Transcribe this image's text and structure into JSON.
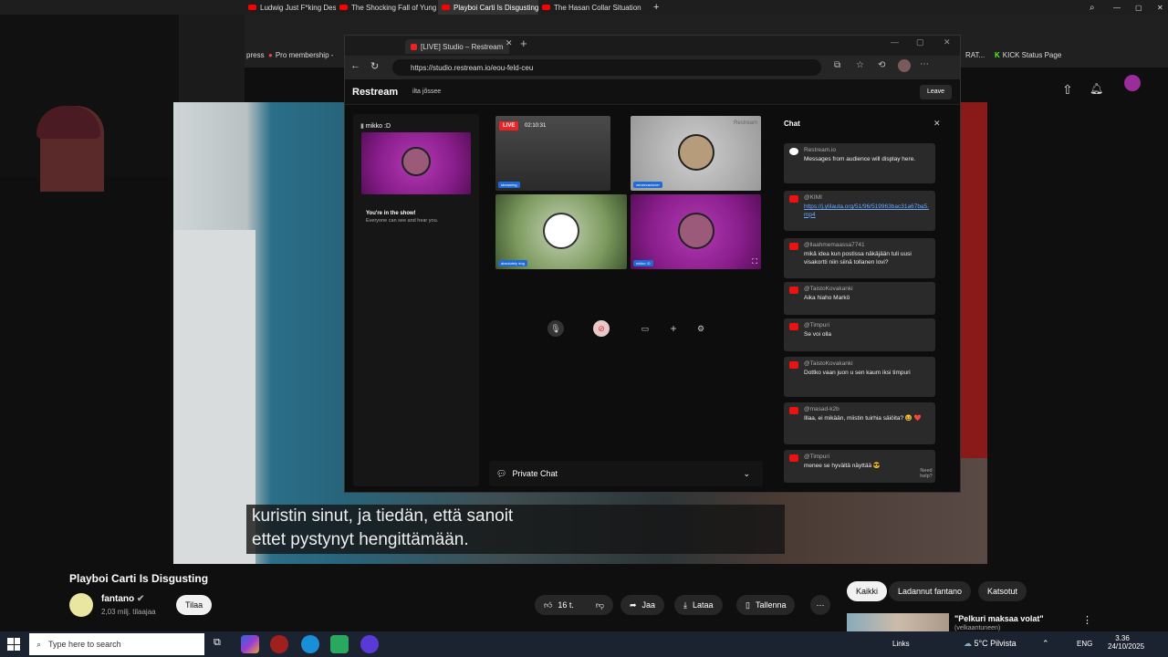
{
  "top_tabs": [
    {
      "label": "Ludwig Just F*king Destr"
    },
    {
      "label": "The Shocking Fall of Yung"
    },
    {
      "label": "Playboi Carti Is Disgusting"
    },
    {
      "label": "The Hasan Collar Situation"
    }
  ],
  "bookmarks": {
    "left": "press",
    "membership": "Pro membership -",
    "right1": "RAT...",
    "kick": "KICK Status Page"
  },
  "restream": {
    "tab_title": "[LIVE] Studio – Restream",
    "url": "https://studio.restream.io/eou-feld-ceu",
    "brand": "Restream",
    "studio_name": "ilta jõssee",
    "leave": "Leave",
    "self_name": "mikko :D",
    "in_show_title": "You're in the show!",
    "in_show_sub": "Everyone can see and hear you.",
    "live_badge": "LIVE",
    "timer": "02:10:31",
    "watermark": "Restream",
    "private_chat": "Private Chat",
    "chat_title": "Chat",
    "need_help": "Need help?",
    "tags": [
      "streaming",
      "veneezaclover",
      "absolutely dog",
      "mikko :D"
    ]
  },
  "chat_messages": [
    {
      "user": "Restream.io",
      "text": "Messages from audience will display here.",
      "icon": "restream"
    },
    {
      "user": "@KIMI",
      "text": "https://j.ylilauta.org/51/96/519963bac31a67ba5.mp4",
      "link": true,
      "icon": "youtube"
    },
    {
      "user": "@llaahmemaassa7741",
      "text": "mikä idea kun postissa näkäjään tuli uusi visakortti niin siinä tollanen lovi?",
      "icon": "youtube"
    },
    {
      "user": "@TaistoKovakanki",
      "text": "Aika hiaho Markö",
      "icon": "youtube"
    },
    {
      "user": "@Timpuri",
      "text": "Se voi olla",
      "icon": "youtube"
    },
    {
      "user": "@TaistoKovakanki",
      "text": "Dottko vaan juon u sen kaum iksi timpuri",
      "icon": "youtube"
    },
    {
      "user": "@masad-k2b",
      "text": "Illaa, ei mikään, miistin tuirhia säiöita? 😆 ❤️",
      "icon": "youtube"
    },
    {
      "user": "@Timpuri",
      "text": "menee se hyvältä näyttää 😎",
      "icon": "youtube"
    }
  ],
  "subtitles": [
    "kuristin sinut, ja tiedän, että sanoit",
    "ettet pystynyt hengittämään."
  ],
  "video": {
    "title": "Playboi Carti Is Disgusting",
    "channel": "fantano",
    "subscribers": "2,03 milj. tilaajaa",
    "subscribe": "Tilaa",
    "likes": "16 t.",
    "share": "Jaa",
    "download": "Lataa",
    "save": "Tallenna"
  },
  "filters": [
    "Kaikki",
    "Ladannut fantano",
    "Katsotut"
  ],
  "recommended": {
    "title": "\"Pelkuri maksaa volat\"",
    "sub": "(velkaantuneen)"
  },
  "taskbar": {
    "search": "Type here to search",
    "links": "Links",
    "weather": "5°C  Pilvista",
    "lang": "ENG",
    "time": "3.36",
    "date": "24/10/2025"
  }
}
